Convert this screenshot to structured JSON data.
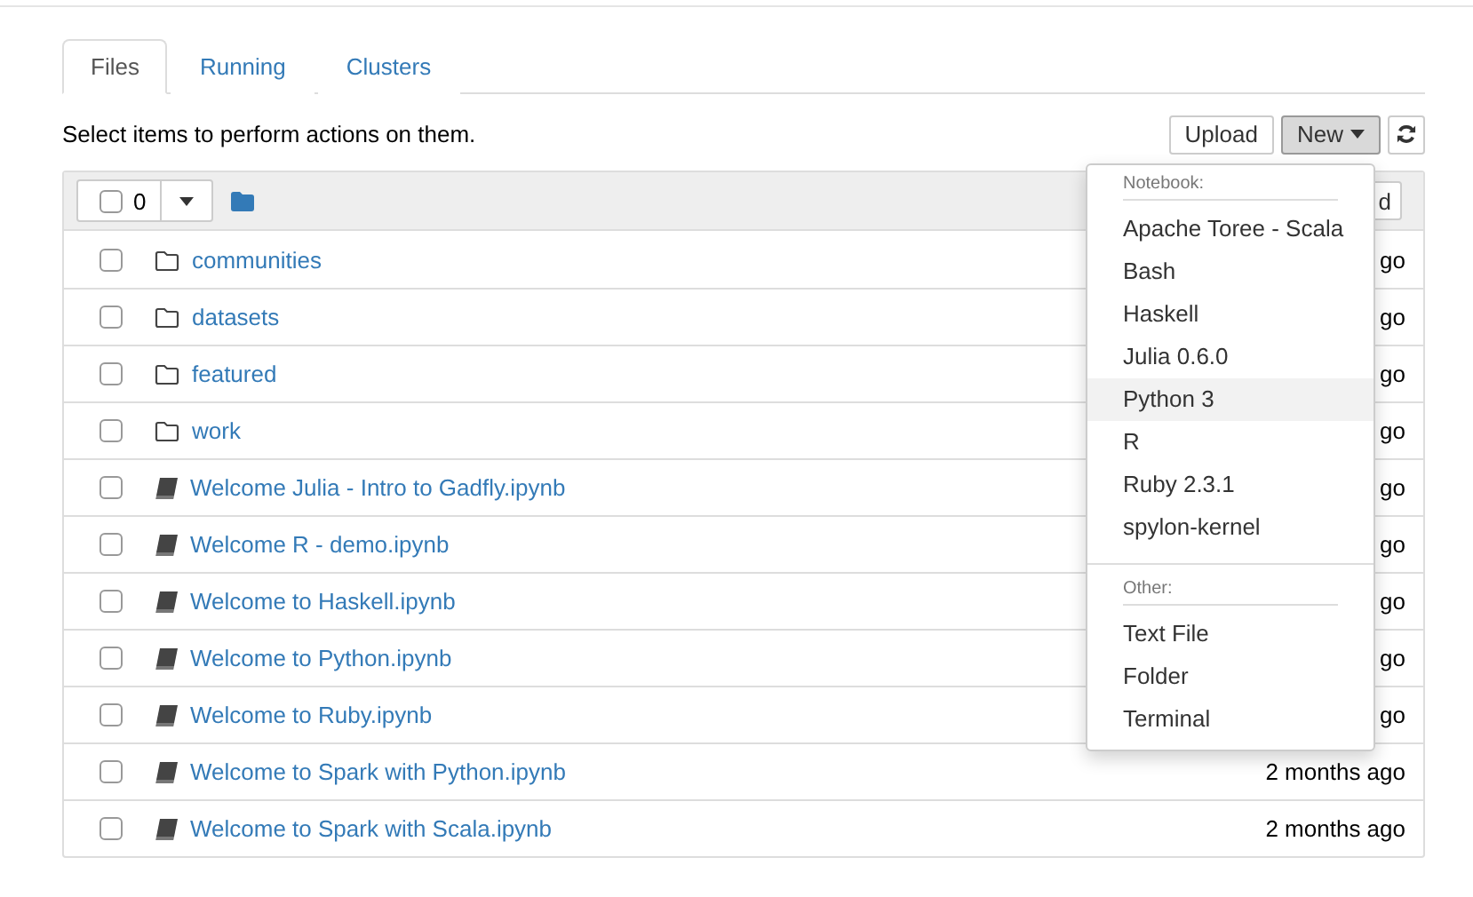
{
  "tabs": [
    {
      "label": "Files",
      "selected": true
    },
    {
      "label": "Running",
      "selected": false
    },
    {
      "label": "Clusters",
      "selected": false
    }
  ],
  "hint": "Select items to perform actions on them.",
  "toolbar": {
    "upload": "Upload",
    "new": "New",
    "new_open": true
  },
  "list_header": {
    "count": "0",
    "select_all": false,
    "sort_button": "d"
  },
  "rows": [
    {
      "kind": "folder",
      "name": "communities",
      "checked": false,
      "modified": "go"
    },
    {
      "kind": "folder",
      "name": "datasets",
      "checked": false,
      "modified": "go"
    },
    {
      "kind": "folder",
      "name": "featured",
      "checked": false,
      "modified": "go"
    },
    {
      "kind": "folder",
      "name": "work",
      "checked": false,
      "modified": "go"
    },
    {
      "kind": "notebook",
      "name": "Welcome Julia - Intro to Gadfly.ipynb",
      "checked": false,
      "modified": "go"
    },
    {
      "kind": "notebook",
      "name": "Welcome R - demo.ipynb",
      "checked": false,
      "modified": "go"
    },
    {
      "kind": "notebook",
      "name": "Welcome to Haskell.ipynb",
      "checked": false,
      "modified": "go"
    },
    {
      "kind": "notebook",
      "name": "Welcome to Python.ipynb",
      "checked": false,
      "modified": "go"
    },
    {
      "kind": "notebook",
      "name": "Welcome to Ruby.ipynb",
      "checked": false,
      "modified": "go"
    },
    {
      "kind": "notebook",
      "name": "Welcome to Spark with Python.ipynb",
      "checked": false,
      "modified": "2 months ago"
    },
    {
      "kind": "notebook",
      "name": "Welcome to Spark with Scala.ipynb",
      "checked": false,
      "modified": "2 months ago"
    }
  ],
  "new_menu": {
    "sections": [
      {
        "heading": "Notebook:",
        "items": [
          {
            "label": "Apache Toree - Scala",
            "selected": false
          },
          {
            "label": "Bash",
            "selected": false
          },
          {
            "label": "Haskell",
            "selected": false
          },
          {
            "label": "Julia 0.6.0",
            "selected": false
          },
          {
            "label": "Python 3",
            "selected": true
          },
          {
            "label": "R",
            "selected": false
          },
          {
            "label": "Ruby 2.3.1",
            "selected": false
          },
          {
            "label": "spylon-kernel",
            "selected": false
          }
        ]
      },
      {
        "heading": "Other:",
        "items": [
          {
            "label": "Text File",
            "selected": false
          },
          {
            "label": "Folder",
            "selected": false
          },
          {
            "label": "Terminal",
            "selected": false
          }
        ]
      }
    ]
  }
}
